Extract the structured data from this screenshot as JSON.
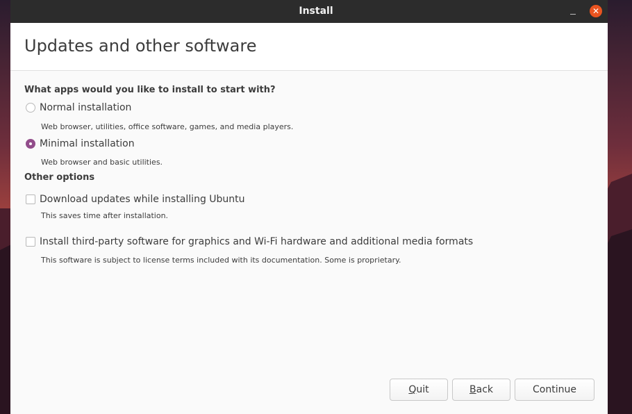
{
  "window": {
    "title": "Install",
    "minimize_icon": "minimize-icon",
    "close_icon": "close-icon",
    "close_glyph": "✕",
    "accent_color": "#e95420",
    "selection_color": "#924d8b"
  },
  "header": {
    "title": "Updates and other software"
  },
  "apps_section": {
    "heading": "What apps would you like to install to start with?",
    "options": [
      {
        "label": "Normal installation",
        "description": "Web browser, utilities, office software, games, and media players.",
        "selected": false
      },
      {
        "label": "Minimal installation",
        "description": "Web browser and basic utilities.",
        "selected": true
      }
    ]
  },
  "other_section": {
    "heading": "Other options",
    "options": [
      {
        "label": "Download updates while installing Ubuntu",
        "description": "This saves time after installation.",
        "checked": false
      },
      {
        "label": "Install third-party software for graphics and Wi-Fi hardware and additional media formats",
        "description": "This software is subject to license terms included with its documentation. Some is proprietary.",
        "checked": false
      }
    ]
  },
  "buttons": {
    "quit_mnemonic": "Q",
    "quit_rest": "uit",
    "back_mnemonic": "B",
    "back_rest": "ack",
    "continue": "Continue"
  }
}
